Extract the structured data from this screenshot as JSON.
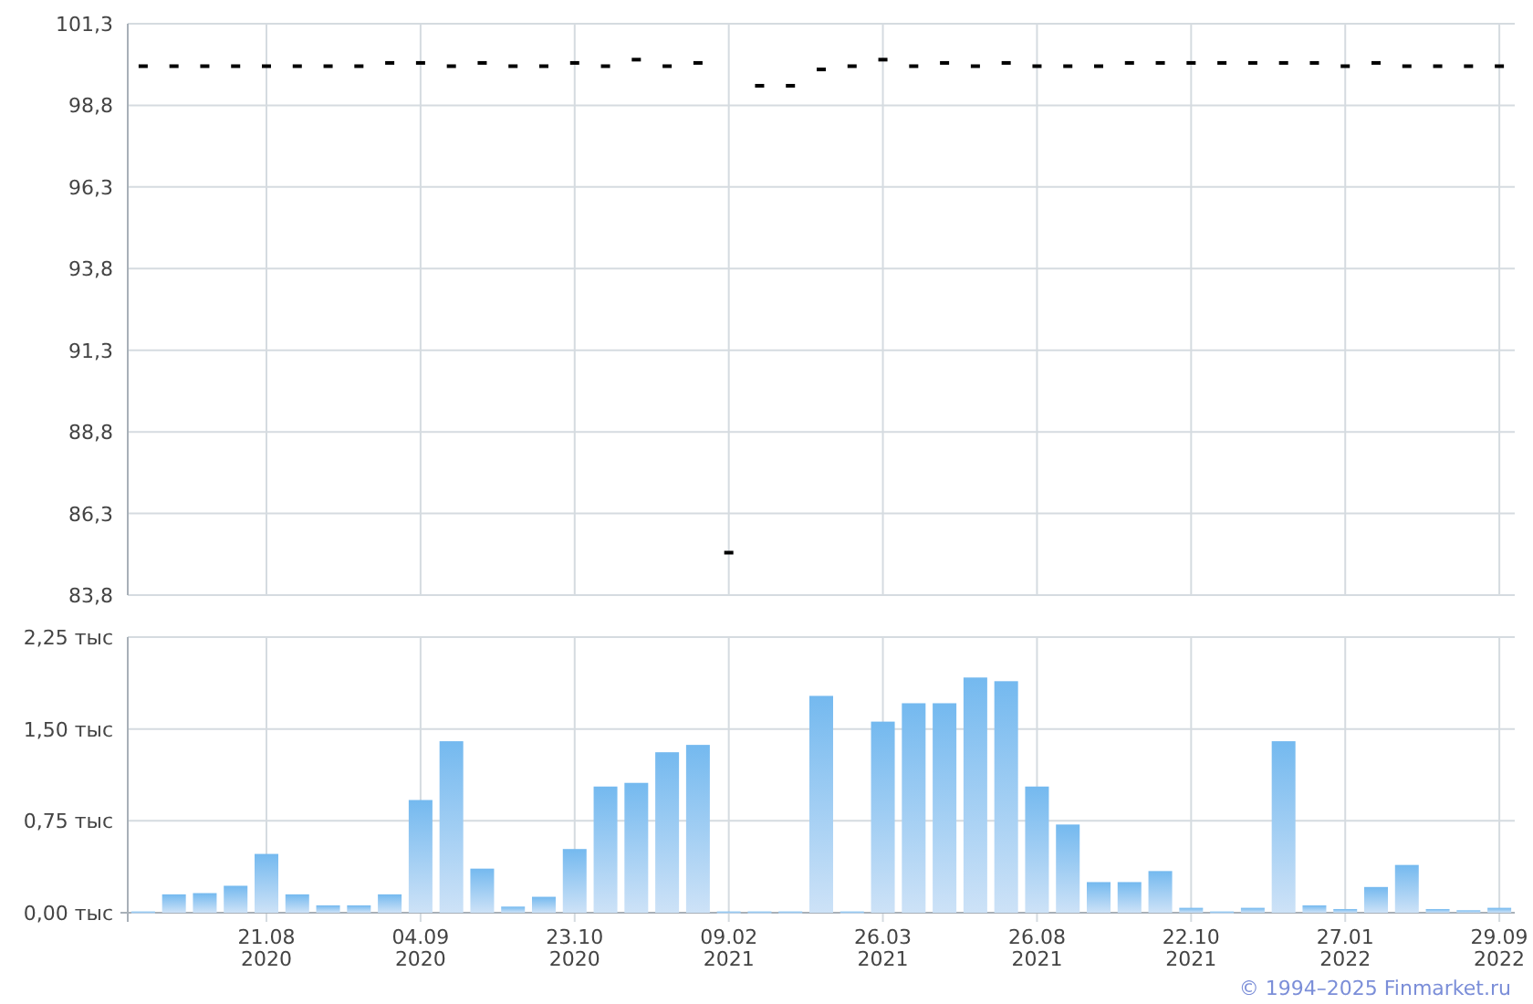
{
  "price_chart": {
    "chart_data": {
      "type": "scatter",
      "grid": true,
      "categories": [
        null,
        null,
        null,
        null,
        null,
        null,
        null,
        null,
        null,
        null,
        null,
        null,
        null,
        null,
        null,
        null,
        null,
        null,
        null,
        null,
        null,
        null,
        null,
        null,
        null,
        null,
        null,
        null,
        null,
        null,
        null,
        null,
        null,
        null,
        null,
        null,
        null,
        null,
        null,
        null,
        null,
        null,
        null,
        null,
        null
      ],
      "series": [
        {
          "color": "#000000",
          "values": [
            100.0,
            100.0,
            100.0,
            100.0,
            100.0,
            100.0,
            100.0,
            100.0,
            100.1,
            100.1,
            100.0,
            100.1,
            100.0,
            100.0,
            100.1,
            100.0,
            100.2,
            100.0,
            100.1,
            85.1,
            99.4,
            99.4,
            99.9,
            100.0,
            100.2,
            100.0,
            100.1,
            100.0,
            100.1,
            100.0,
            100.0,
            100.0,
            100.1,
            100.1,
            100.1,
            100.1,
            100.1,
            100.1,
            100.1,
            100.0,
            100.1,
            100.0,
            100.0,
            100.0,
            100.0
          ]
        }
      ],
      "ylim": [
        83.8,
        101.3
      ],
      "yticks": [
        {
          "value": 83.8,
          "label": "83,8"
        },
        {
          "value": 86.3,
          "label": "86,3"
        },
        {
          "value": 88.8,
          "label": "88,8"
        },
        {
          "value": 91.3,
          "label": "91,3"
        },
        {
          "value": 93.8,
          "label": "93,8"
        },
        {
          "value": 96.3,
          "label": "96,3"
        },
        {
          "value": 98.8,
          "label": "98,8"
        },
        {
          "value": 101.3,
          "label": "101,3"
        }
      ]
    }
  },
  "volume_chart": {
    "chart_data": {
      "type": "bar",
      "grid": true,
      "categories": [
        null,
        null,
        null,
        null,
        "21.08 2020",
        null,
        null,
        null,
        null,
        "04.09 2020",
        null,
        null,
        null,
        null,
        "23.10 2020",
        null,
        null,
        null,
        null,
        "09.02 2021",
        null,
        null,
        null,
        null,
        "26.03 2021",
        null,
        null,
        null,
        null,
        "26.08 2021",
        null,
        null,
        null,
        null,
        "22.10 2021",
        null,
        null,
        null,
        null,
        "27.01 2022",
        null,
        null,
        null,
        null,
        "29.09 2022"
      ],
      "series": [
        {
          "color": "#74b9ef",
          "values": [
            0.01,
            0.15,
            0.16,
            0.22,
            0.48,
            0.15,
            0.06,
            0.06,
            0.15,
            0.92,
            1.4,
            0.36,
            0.05,
            0.13,
            0.52,
            1.03,
            1.06,
            1.31,
            1.37,
            0.01,
            0.01,
            0.01,
            1.77,
            0.01,
            1.56,
            1.71,
            1.71,
            1.92,
            1.89,
            1.03,
            0.72,
            0.25,
            0.25,
            0.34,
            0.04,
            0.01,
            0.04,
            1.4,
            0.06,
            0.03,
            0.21,
            0.39,
            0.03,
            0.02,
            0.04
          ]
        }
      ],
      "ylim": [
        0,
        2.25
      ],
      "yticks": [
        {
          "value": 0,
          "label": "0,00 тыс"
        },
        {
          "value": 0.75,
          "label": "0,75 тыс"
        },
        {
          "value": 1.5,
          "label": "1,50 тыс"
        },
        {
          "value": 2.25,
          "label": "2,25 тыс"
        }
      ]
    }
  },
  "footer": {
    "copyright": "© 1994–2025 Finmarket.ru"
  }
}
